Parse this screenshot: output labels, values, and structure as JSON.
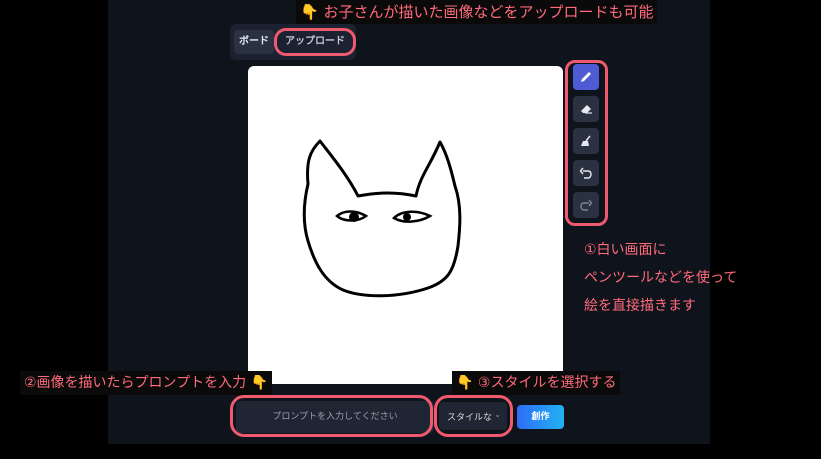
{
  "tabs": [
    {
      "label": "ボード"
    },
    {
      "label": "アップロード"
    }
  ],
  "toolbar": {
    "tools": [
      {
        "icon": "pencil-icon",
        "active": true
      },
      {
        "icon": "eraser-icon",
        "active": false
      },
      {
        "icon": "broom-icon",
        "active": false
      },
      {
        "icon": "undo-icon",
        "active": false
      },
      {
        "icon": "redo-icon",
        "active": false
      }
    ]
  },
  "annotations": {
    "upload_note": "お子さんが描いた画像などをアップロードも可能",
    "toolbar_note": [
      "①白い画面に",
      "ペンツールなどを使って",
      "絵を直接描きます"
    ],
    "prompt_note": "②画像を描いたらプロンプトを入力",
    "style_note": "③スタイルを選択する",
    "pointer_glyph": "👇"
  },
  "bottom_bar": {
    "prompt_placeholder": "プロンプトを入力してください",
    "style_label": "スタイルな",
    "create_label": "創作"
  },
  "colors": {
    "highlight_ring": "#f05a6e",
    "annotation_text": "#ff6b7a",
    "pointer": "#f3b22d",
    "active_tool": "#4f5bd5",
    "create_button": "#2d8ff5"
  }
}
